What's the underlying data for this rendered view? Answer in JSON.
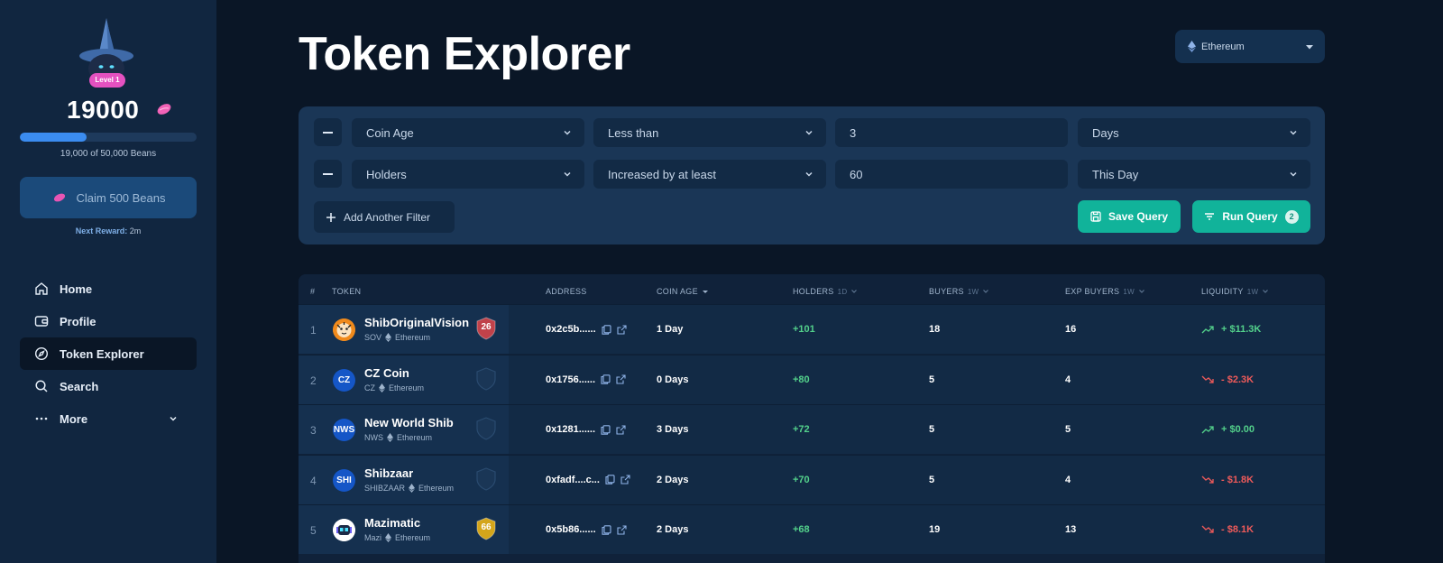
{
  "sidebar": {
    "level_badge": "Level 1",
    "beans_count": "19000",
    "progress_fraction": 0.38,
    "progress_label": "19,000 of 50,000 Beans",
    "claim_label": "Claim 500 Beans",
    "next_reward_label": "Next Reward:",
    "next_reward_value": "2m",
    "nav": [
      {
        "label": "Home",
        "icon": "home-icon"
      },
      {
        "label": "Profile",
        "icon": "wallet-icon"
      },
      {
        "label": "Token Explorer",
        "icon": "compass-icon"
      },
      {
        "label": "Search",
        "icon": "search-icon"
      },
      {
        "label": "More",
        "icon": "dots-icon"
      }
    ]
  },
  "header": {
    "title": "Token Explorer",
    "chain": "Ethereum"
  },
  "filters": {
    "row1": {
      "field": "Coin Age",
      "op": "Less than",
      "value": "3",
      "unit": "Days"
    },
    "row2": {
      "field": "Holders",
      "op": "Increased by at least",
      "value": "60",
      "unit": "This Day"
    },
    "add_label": "Add Another Filter",
    "save_label": "Save Query",
    "run_label": "Run Query",
    "run_count": "2"
  },
  "table": {
    "headers": {
      "rank": "#",
      "token": "TOKEN",
      "address": "ADDRESS",
      "coin_age": "COIN AGE",
      "holders": "HOLDERS",
      "holders_sub": "1D",
      "buyers": "BUYERS",
      "buyers_sub": "1W",
      "exp_buyers": "EXP BUYERS",
      "exp_buyers_sub": "1W",
      "liquidity": "LIQUIDITY",
      "liquidity_sub": "1W"
    },
    "rows": [
      {
        "rank": "1",
        "logo": "",
        "name": "ShibOriginalVision",
        "symbol": "SOV",
        "chain": "Ethereum",
        "score": "26",
        "address": "0x2c5b......",
        "age": "1 Day",
        "holders": "+101",
        "buyers": "18",
        "exp_buyers": "16",
        "liquidity": "+ $11.3K",
        "trend": "up"
      },
      {
        "rank": "2",
        "logo": "CZ",
        "name": "CZ Coin",
        "symbol": "CZ",
        "chain": "Ethereum",
        "score": "",
        "address": "0x1756......",
        "age": "0 Days",
        "holders": "+80",
        "buyers": "5",
        "exp_buyers": "4",
        "liquidity": "- $2.3K",
        "trend": "down"
      },
      {
        "rank": "3",
        "logo": "NWS",
        "name": "New World Shib",
        "symbol": "NWS",
        "chain": "Ethereum",
        "score": "",
        "address": "0x1281......",
        "age": "3 Days",
        "holders": "+72",
        "buyers": "5",
        "exp_buyers": "5",
        "liquidity": "+ $0.00",
        "trend": "up"
      },
      {
        "rank": "4",
        "logo": "SHI",
        "name": "Shibzaar",
        "symbol": "SHIBZAAR",
        "chain": "Ethereum",
        "score": "",
        "address": "0xfadf....c...",
        "age": "2 Days",
        "holders": "+70",
        "buyers": "5",
        "exp_buyers": "4",
        "liquidity": "- $1.8K",
        "trend": "down"
      },
      {
        "rank": "5",
        "logo": "",
        "name": "Mazimatic",
        "symbol": "Mazi",
        "chain": "Ethereum",
        "score": "66",
        "address": "0x5b86......",
        "age": "2 Days",
        "holders": "+68",
        "buyers": "19",
        "exp_buyers": "13",
        "liquidity": "- $8.1K",
        "trend": "down"
      }
    ]
  },
  "colors": {
    "accent": "#11b39a",
    "positive": "#53d18b",
    "negative": "#ee5a5a",
    "shield_red": "#c0424a",
    "shield_gold": "#d4a51a"
  }
}
